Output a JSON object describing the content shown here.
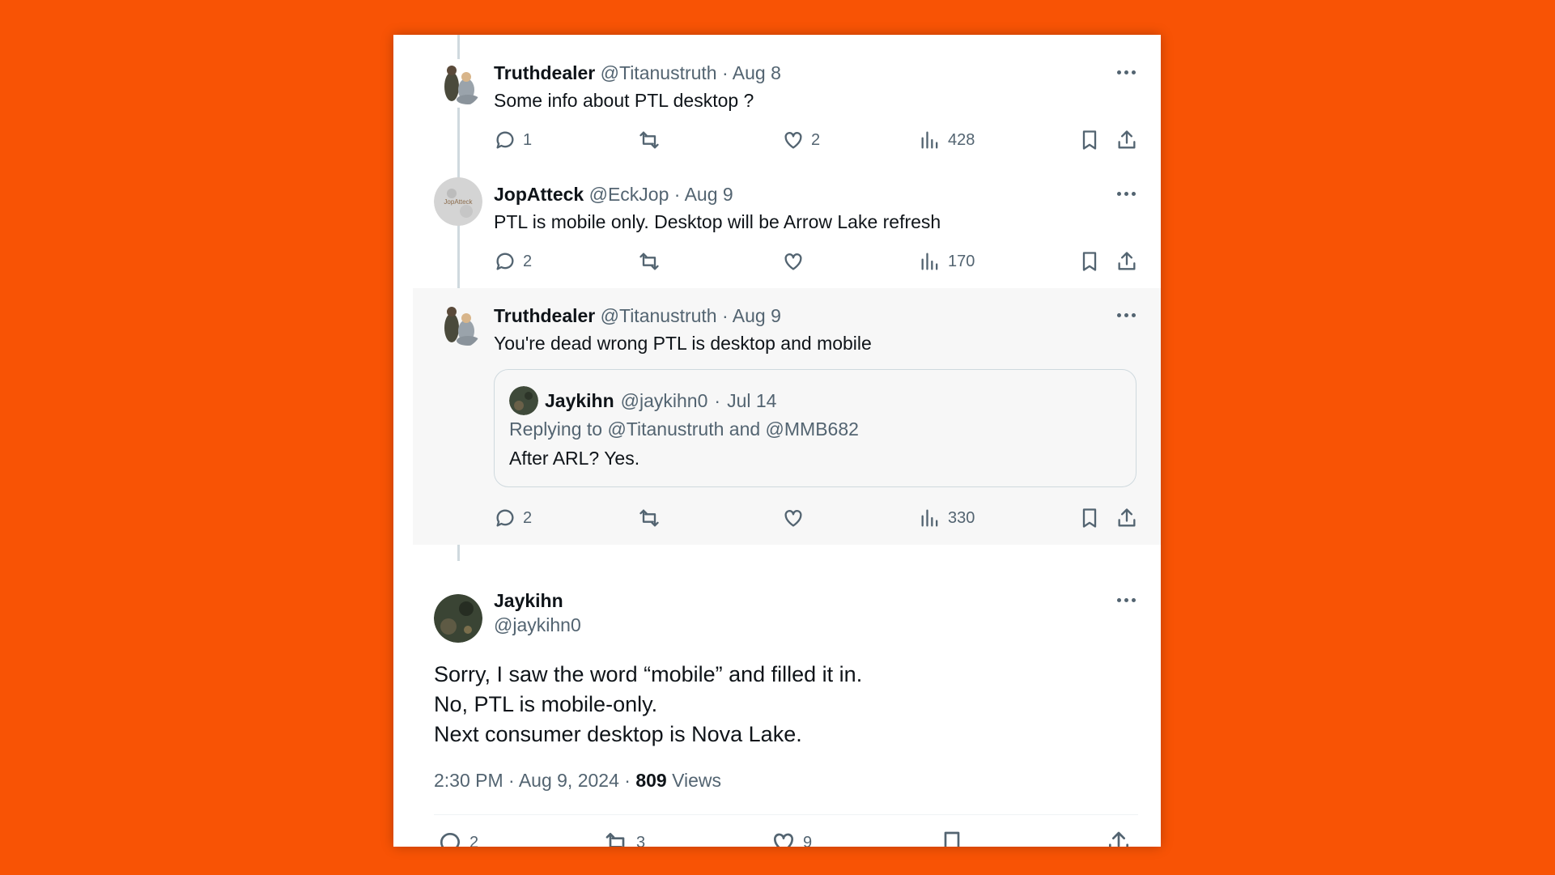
{
  "tweets": [
    {
      "name": "Truthdealer",
      "handle": "@Titanustruth",
      "separator": "·",
      "date": "Aug 8",
      "text": "Some info about PTL desktop ?",
      "replies": "1",
      "retweets": "",
      "likes": "2",
      "views": "428"
    },
    {
      "name": "JopAtteck",
      "handle": "@EckJop",
      "separator": "·",
      "date": "Aug 9",
      "text": "PTL is mobile only.  Desktop will be Arrow Lake refresh",
      "replies": "2",
      "retweets": "",
      "likes": "",
      "views": "170"
    },
    {
      "name": "Truthdealer",
      "handle": "@Titanustruth",
      "separator": "·",
      "date": "Aug 9",
      "text": "You're dead wrong PTL is desktop and mobile",
      "replies": "2",
      "retweets": "",
      "likes": "",
      "views": "330",
      "quote": {
        "name": "Jaykihn",
        "handle": "@jaykihn0",
        "separator": "·",
        "date": "Jul 14",
        "replying": "Replying to @Titanustruth and @MMB682",
        "text": "After ARL? Yes."
      }
    }
  ],
  "main_tweet": {
    "name": "Jaykihn",
    "handle": "@jaykihn0",
    "lines": [
      "Sorry, I saw the word “mobile” and filled it in.",
      "No, PTL is mobile-only.",
      "Next consumer desktop is Nova Lake."
    ],
    "time": "2:30 PM · Aug 9, 2024 · ",
    "views_count": "809",
    "views_label": " Views",
    "replies": "2",
    "retweets": "3",
    "likes": "9"
  },
  "colors": {
    "background": "#F85305",
    "card": "#ffffff",
    "secondary_text": "#536471",
    "highlight": "#f7f7f7"
  },
  "icons": [
    "reply-icon",
    "retweet-icon",
    "like-icon",
    "views-icon",
    "bookmark-icon",
    "share-icon",
    "more-icon"
  ]
}
